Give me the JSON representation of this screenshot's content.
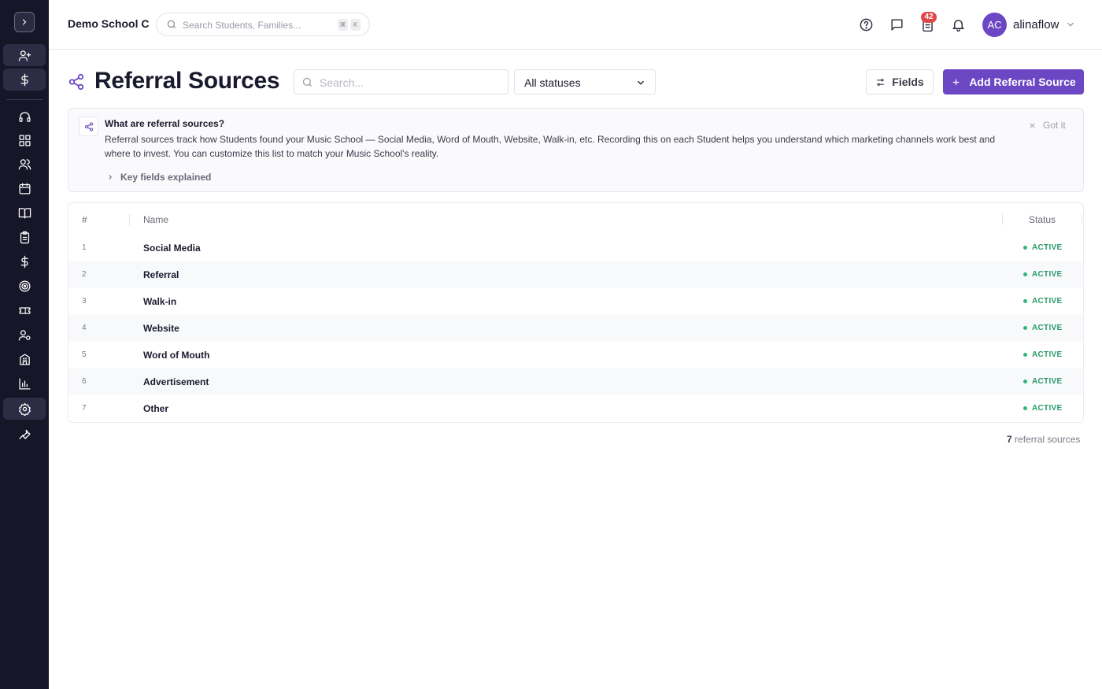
{
  "app": {
    "school_name": "Demo School C",
    "user_name": "alinaflow",
    "user_initials": "AC",
    "notifications_count": "42"
  },
  "global_search": {
    "placeholder": "Search Students, Families...",
    "shortcut_mod": "⌘",
    "shortcut_key": "K"
  },
  "page": {
    "title": "Referral Sources",
    "search_placeholder": "Search...",
    "status_filter": "All statuses",
    "fields_label": "Fields",
    "add_label": "Add Referral Source"
  },
  "info": {
    "title": "What are referral sources?",
    "body": "Referral sources track how Students found your Music School — Social Media, Word of Mouth, Website, Walk-in, etc. Recording this on each Student helps you understand which marketing channels work best and where to invest. You can customize this list to match your Music School's reality.",
    "key_fields": "Key fields explained",
    "dismiss": "Got it"
  },
  "table": {
    "columns": {
      "num": "#",
      "name": "Name",
      "status": "Status"
    },
    "rows": [
      {
        "num": "1",
        "name": "Social Media",
        "status": "ACTIVE"
      },
      {
        "num": "2",
        "name": "Referral",
        "status": "ACTIVE"
      },
      {
        "num": "3",
        "name": "Walk-in",
        "status": "ACTIVE"
      },
      {
        "num": "4",
        "name": "Website",
        "status": "ACTIVE"
      },
      {
        "num": "5",
        "name": "Word of Mouth",
        "status": "ACTIVE"
      },
      {
        "num": "6",
        "name": "Advertisement",
        "status": "ACTIVE"
      },
      {
        "num": "7",
        "name": "Other",
        "status": "ACTIVE"
      }
    ]
  },
  "footer": {
    "count": "7",
    "count_label": "referral sources"
  },
  "colors": {
    "accent": "#6b47c4",
    "sidebar": "#161628",
    "active_status": "#2a9a6a",
    "badge": "#e04848"
  },
  "sidebar": {
    "icons": [
      "add-user-icon",
      "dollar-icon",
      "headset-icon",
      "dashboard-icon",
      "users-icon",
      "calendar-icon",
      "book-icon",
      "clipboard-icon",
      "dollar-icon",
      "target-icon",
      "ticket-icon",
      "user-settings-icon",
      "building-icon",
      "chart-icon",
      "gear-icon",
      "wrench-icon"
    ]
  }
}
